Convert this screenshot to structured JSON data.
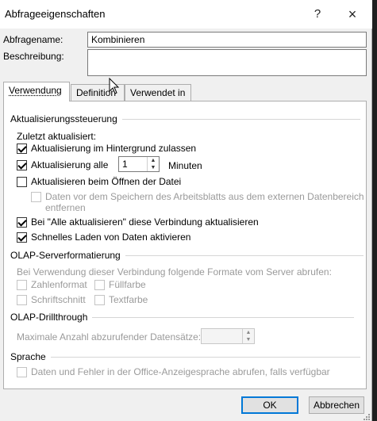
{
  "window": {
    "title": "Abfrageeigenschaften",
    "help": "?",
    "close": "×"
  },
  "form": {
    "name_label": "Abfragename:",
    "name_value": "Kombinieren",
    "description_label": "Beschreibung:",
    "description_value": ""
  },
  "tabs": [
    {
      "label": "Verwendung",
      "active": true
    },
    {
      "label": "Definition",
      "active": false
    },
    {
      "label": "Verwendet in",
      "active": false
    }
  ],
  "refresh": {
    "header": "Aktualisierungssteuerung",
    "last_updated": "Zuletzt aktualisiert:",
    "background": {
      "label": "Aktualisierung im Hintergrund zulassen",
      "checked": true
    },
    "every": {
      "label": "Aktualisierung alle",
      "checked": true,
      "value": "1",
      "unit": "Minuten"
    },
    "on_open": {
      "label": "Aktualisieren beim Öffnen der Datei",
      "checked": false
    },
    "remove_data": {
      "label_line1": "Daten vor dem Speichern des Arbeitsblatts aus dem externen Datenbereich",
      "label_line2": "entfernen",
      "checked": false,
      "disabled": true
    },
    "refresh_all": {
      "label": "Bei \"Alle aktualisieren\" diese Verbindung aktualisieren",
      "checked": true
    },
    "fast_load": {
      "label": "Schnelles Laden von Daten aktivieren",
      "checked": true
    }
  },
  "olap_format": {
    "header": "OLAP-Serverformatierung",
    "intro": "Bei Verwendung dieser Verbindung folgende Formate vom Server abrufen:",
    "number_format": "Zahlenformat",
    "fill_color": "Füllfarbe",
    "font_style": "Schriftschnitt",
    "text_color": "Textfarbe"
  },
  "olap_drill": {
    "header": "OLAP-Drillthrough",
    "max_records": "Maximale Anzahl abzurufender Datensätze:",
    "max_value": ""
  },
  "language": {
    "header": "Sprache",
    "office_lang": "Daten und Fehler in der Office-Anzeigesprache abrufen, falls verfügbar"
  },
  "buttons": {
    "ok": "OK",
    "cancel": "Abbrechen"
  },
  "icons": {
    "cursor": "mouse-pointer-icon",
    "resize": "resize-grip-icon"
  }
}
